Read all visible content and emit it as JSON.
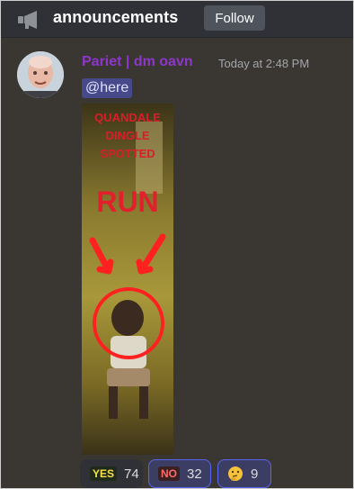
{
  "header": {
    "channel_name": "announcements",
    "follow_label": "Follow",
    "icon": "megaphone-icon"
  },
  "message": {
    "username": "Pariet | dm oavn",
    "username_color": "#8e36c9",
    "timestamp": "Today at 2:48 PM",
    "mention": "@here",
    "image": {
      "caption_lines": [
        "QUANDALE",
        "DINGLE",
        "SPOTTED"
      ],
      "headline": "RUN"
    }
  },
  "reactions": [
    {
      "emoji": "YES",
      "count": "74",
      "selected": false
    },
    {
      "emoji": "NO",
      "count": "32",
      "selected": true
    },
    {
      "emoji": "thinking-face-icon",
      "count": "9",
      "selected": true
    }
  ],
  "colors": {
    "background": "#3a3732",
    "header": "#2f3136",
    "mention_bg": "#474a8a",
    "accent": "#5865f2"
  }
}
